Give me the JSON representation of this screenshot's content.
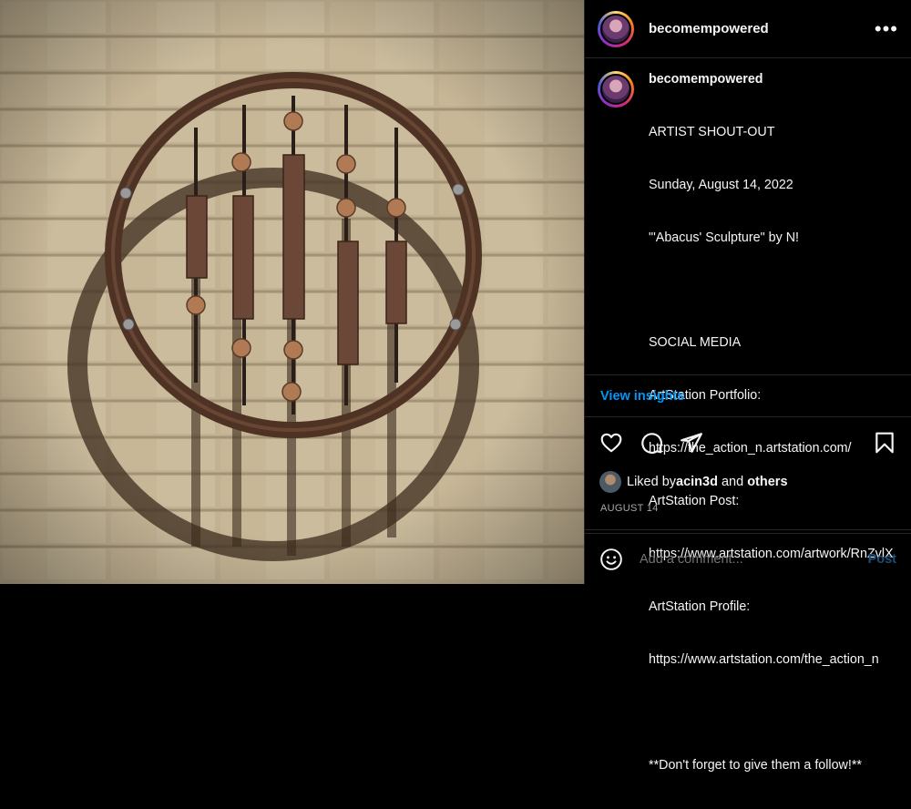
{
  "post": {
    "username": "becomempowered",
    "more_label": "•••",
    "caption_lines": [
      "ARTIST SHOUT-OUT",
      "Sunday, August 14, 2022",
      "\"'Abacus' Sculpture\" by N!",
      "",
      "SOCIAL MEDIA",
      "ArtStation Portfolio:",
      "https://the_action_n.artstation.com/",
      "ArtStation Post:",
      "https://www.artstation.com/artwork/RnZvlX",
      "ArtStation Profile:",
      "https://www.artstation.com/the_action_n",
      "",
      "**Don't forget to give them a follow!**"
    ],
    "insights_label": "View insights",
    "liked_prefix": "Liked by ",
    "liked_user": "acin3d",
    "liked_mid": " and ",
    "liked_others": "others",
    "date": "AUGUST 14",
    "comment_placeholder": "Add a comment...",
    "post_label": "Post"
  },
  "icons": {
    "like": "heart-icon",
    "comment": "comment-icon",
    "share": "share-icon",
    "save": "bookmark-icon",
    "emoji": "emoji-icon"
  },
  "colors": {
    "accent": "#0095f6",
    "background": "#000000",
    "post_disabled": "#1c4f7a"
  }
}
